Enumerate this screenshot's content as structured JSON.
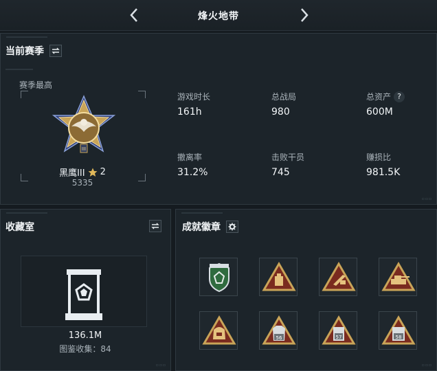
{
  "header": {
    "title": "烽火地带",
    "prev_icon": "chevron-left-icon",
    "next_icon": "chevron-right-icon"
  },
  "season": {
    "title": "当前赛季",
    "highest_label": "赛季最高",
    "rank_name": "黑鹰III",
    "rank_stars": "2",
    "rank_points": "5335",
    "stats": [
      {
        "label": "游戏时长",
        "value": "161h"
      },
      {
        "label": "总战局",
        "value": "980"
      },
      {
        "label": "总资产",
        "value": "600M",
        "help": "?"
      },
      {
        "label": "撤离率",
        "value": "31.2%"
      },
      {
        "label": "击败干员",
        "value": "745"
      },
      {
        "label": "赚损比",
        "value": "981.5K"
      }
    ]
  },
  "collection": {
    "title": "收藏室",
    "value": "136.1M",
    "count_label": "图鉴收集：84"
  },
  "achievements": {
    "title": "成就徽章",
    "badges": [
      {
        "icon": "green-shield-badge-icon",
        "color": "#2f6b3e"
      },
      {
        "icon": "box-triangle-badge-icon",
        "color": "#b37a2a"
      },
      {
        "icon": "rocket-triangle-badge-icon",
        "color": "#b37a2a"
      },
      {
        "icon": "vehicle-triangle-badge-icon",
        "color": "#b37a2a"
      },
      {
        "icon": "bag-triangle-badge-icon",
        "color": "#b37a2a"
      },
      {
        "icon": "armor-56-triangle-badge-icon",
        "label": "56",
        "color": "#b37a2a"
      },
      {
        "icon": "armor-57-triangle-badge-icon",
        "label": "57",
        "color": "#b37a2a"
      },
      {
        "icon": "armor-58-triangle-badge-icon",
        "label": "58",
        "color": "#b37a2a"
      }
    ]
  },
  "colors": {
    "background": "#151b20",
    "panel": "#1c242a",
    "gold": "#c9a458",
    "badge_red": "#7a2b1f"
  }
}
